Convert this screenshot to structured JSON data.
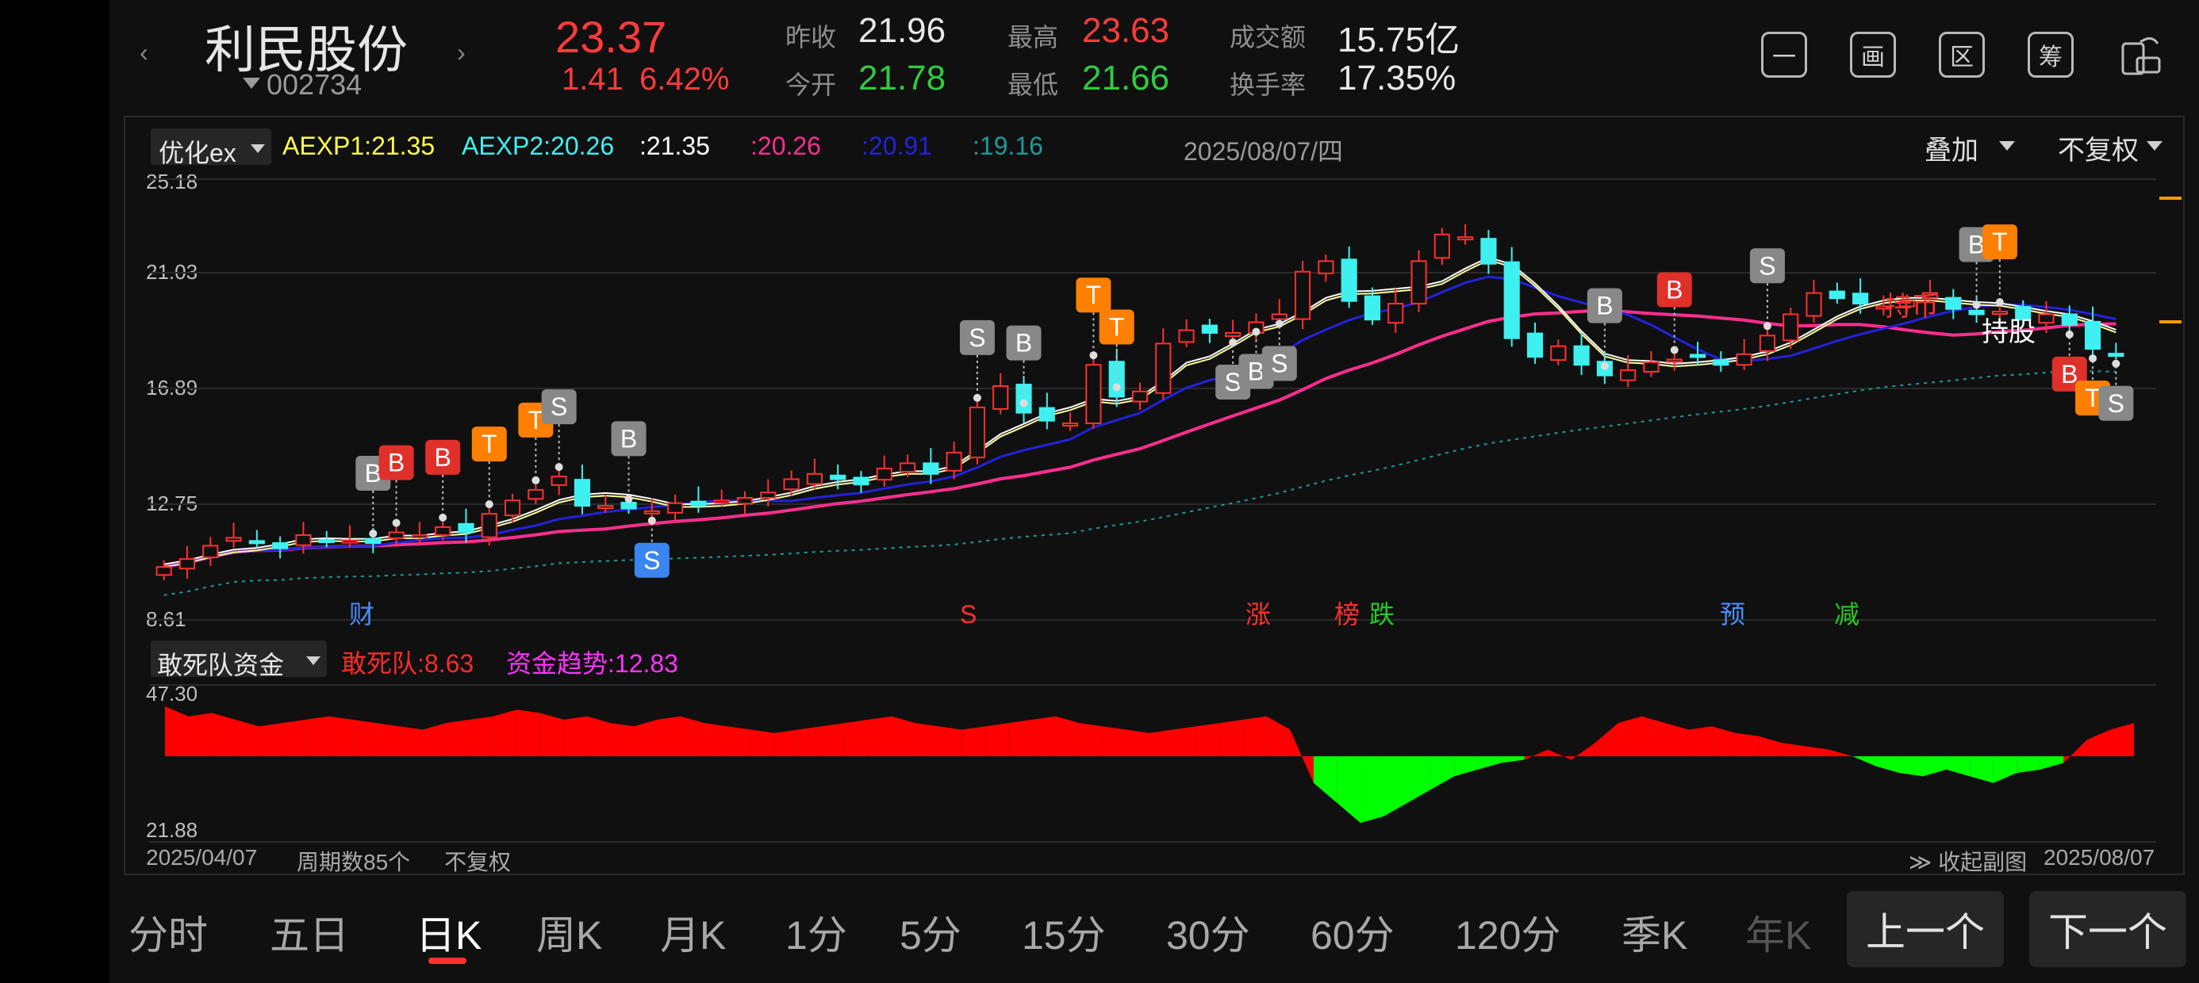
{
  "header": {
    "prev_arrow": "‹",
    "next_arrow": "›",
    "name": "利民股份",
    "code": "002734",
    "price": "23.37",
    "change": "1.41",
    "change_pct": "6.42%",
    "stats": {
      "prev_close_label": "昨收",
      "prev_close": "21.96",
      "open_label": "今开",
      "open": "21.78",
      "high_label": "最高",
      "high": "23.63",
      "low_label": "最低",
      "low": "21.66",
      "volume_label": "成交额",
      "volume": "15.75亿",
      "turnover_label": "换手率",
      "turnover": "17.35%"
    },
    "toolbar": [
      "一",
      "画",
      "区",
      "筹",
      ""
    ]
  },
  "chart": {
    "indicator": "优化ex",
    "legend": [
      {
        "text": "AEXP1:",
        "value": "21.35",
        "color": "#ffff4d"
      },
      {
        "text": "AEXP2:",
        "value": "20.26",
        "color": "#3ff0f0"
      },
      {
        "text": ":",
        "value": "21.35",
        "color": "#ffffff"
      },
      {
        "text": ":",
        "value": "20.26",
        "color": "#ff2e8e"
      },
      {
        "text": ":",
        "value": "20.91",
        "color": "#2222dd"
      },
      {
        "text": ":",
        "value": "19.16",
        "color": "#1f9a9a"
      }
    ],
    "date": "2025/08/07/四",
    "overlay": "叠加",
    "adjust": "不复权",
    "y_labels": [
      "25.18",
      "21.03",
      "16.89",
      "12.75",
      "8.61"
    ],
    "sub_indicator": "敢死队资金",
    "sub_legend": [
      {
        "text": "敢死队:8.63",
        "color": "#ff2a2a"
      },
      {
        "text": "资金趋势:12.83",
        "color": "#ff33ff"
      }
    ],
    "sub_y_labels": [
      "47.30",
      "21.88"
    ],
    "start_date": "2025/04/07",
    "period_count": "周期数85个",
    "adj_footer": "不复权",
    "collapse": "收起副图",
    "end_date": "2025/08/07",
    "annotations": {
      "hold_coin": "持币",
      "hold_stock": "持股"
    },
    "event_tags": [
      {
        "text": "财",
        "color": "#4a8cff"
      },
      {
        "text": "S",
        "color": "#ff3030"
      },
      {
        "text": "涨",
        "color": "#ff3030"
      },
      {
        "text": "榜",
        "color": "#ff3030"
      },
      {
        "text": "跌",
        "color": "#22cc22"
      },
      {
        "text": "预",
        "color": "#4a8cff"
      },
      {
        "text": "减",
        "color": "#22cc22"
      }
    ],
    "signal_letters": [
      "B",
      "S",
      "T"
    ],
    "chart_data": {
      "type": "candlestick",
      "y_range": [
        8.61,
        25.18
      ],
      "candles_count": 85,
      "closes": [
        10.6,
        10.9,
        11.4,
        11.7,
        11.5,
        11.3,
        11.8,
        11.6,
        11.6,
        11.5,
        11.9,
        11.8,
        12.1,
        11.9,
        12.6,
        13.1,
        13.5,
        14.0,
        12.9,
        12.9,
        12.8,
        12.7,
        13.0,
        12.9,
        13.1,
        13.2,
        13.4,
        13.9,
        14.1,
        13.9,
        13.7,
        14.3,
        14.5,
        14.1,
        14.9,
        16.6,
        17.4,
        16.4,
        16.1,
        16.0,
        18.2,
        17.0,
        17.2,
        19.0,
        19.5,
        19.4,
        19.4,
        19.8,
        20.1,
        21.7,
        22.1,
        20.6,
        19.9,
        20.5,
        22.1,
        23.1,
        23.0,
        22.0,
        19.2,
        18.5,
        18.9,
        18.2,
        17.8,
        18.0,
        18.3,
        18.4,
        18.5,
        18.2,
        18.6,
        19.3,
        20.1,
        20.9,
        20.7,
        20.5,
        20.4,
        20.6,
        20.9,
        20.3,
        20.1,
        20.2,
        19.9,
        20.1,
        19.7,
        18.8,
        18.6
      ]
    },
    "sub_chart_data": {
      "type": "area",
      "values": [
        15,
        12,
        13,
        11,
        9,
        10,
        11,
        12,
        11,
        10,
        9,
        8,
        10,
        11,
        12,
        14,
        13,
        11,
        12,
        10,
        9,
        11,
        12,
        10,
        9,
        8,
        7,
        8,
        9,
        10,
        11,
        12,
        10,
        9,
        8,
        9,
        10,
        11,
        12,
        10,
        9,
        8,
        7,
        8,
        9,
        10,
        11,
        12,
        8,
        -8,
        -14,
        -20,
        -18,
        -14,
        -10,
        -6,
        -4,
        -2,
        -1,
        2,
        -1,
        4,
        10,
        12,
        10,
        8,
        9,
        7,
        6,
        4,
        3,
        2,
        0,
        -3,
        -5,
        -6,
        -4,
        -6,
        -8,
        -5,
        -4,
        -2,
        5,
        8,
        10
      ]
    }
  },
  "footer": {
    "tabs": [
      "分时",
      "五日",
      "日K",
      "周K",
      "月K",
      "1分",
      "5分",
      "15分",
      "30分",
      "60分",
      "120分",
      "季K",
      "年K"
    ],
    "active": "日K",
    "prev": "上一个",
    "next": "下一个"
  }
}
